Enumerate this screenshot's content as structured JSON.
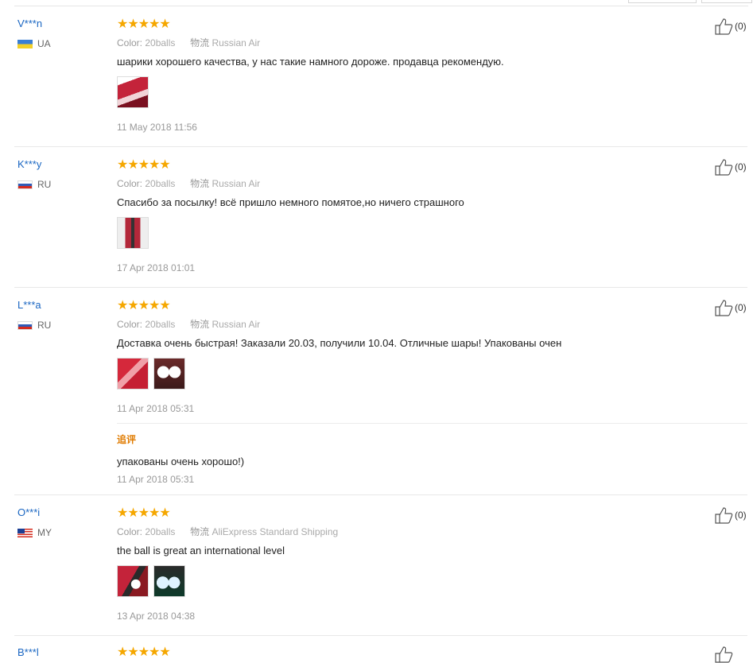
{
  "labels": {
    "color": "Color:",
    "shipping": "物流",
    "additional_review": "追评"
  },
  "reviews": [
    {
      "name": "V***n",
      "country": "UA",
      "flag": "ua",
      "stars": "★★★★★",
      "color_value": "20balls",
      "shipping_value": "Russian Air",
      "text": "шарики хорошего качества, у нас такие намного дороже. продавца рекомендую.",
      "images": [
        "red-box"
      ],
      "date": "11 May 2018 11:56",
      "likes": "(0)"
    },
    {
      "name": "K***y",
      "country": "RU",
      "flag": "ru",
      "stars": "★★★★★",
      "color_value": "20balls",
      "shipping_value": "Russian Air",
      "text": "Спасибо за посылку! всё пришло немного помятое,но ничего страшного",
      "images": [
        "red-tube"
      ],
      "date": "17 Apr 2018 01:01",
      "likes": "(0)"
    },
    {
      "name": "L***a",
      "country": "RU",
      "flag": "ru",
      "stars": "★★★★★",
      "color_value": "20balls",
      "shipping_value": "Russian Air",
      "text": "Доставка очень быстрая! Заказали 20.03, получили 10.04. Отличные шары! Упакованы очен",
      "images": [
        "red-pack",
        "white-balls"
      ],
      "date": "11 Apr 2018 05:31",
      "likes": "(0)",
      "followup": {
        "text": "упакованы очень хорошо!)",
        "date": "11 Apr 2018 05:31"
      }
    },
    {
      "name": "O***i",
      "country": "MY",
      "flag": "my",
      "stars": "★★★★★",
      "color_value": "20balls",
      "shipping_value": "AliExpress Standard Shipping",
      "text": "the ball is great an international level",
      "images": [
        "red-ball",
        "balls-dark"
      ],
      "date": "13 Apr 2018 04:38",
      "likes": "(0)"
    },
    {
      "name": "B***l",
      "stars": "★★★★★"
    }
  ],
  "icons": {
    "like": "thumbs-up-icon"
  }
}
